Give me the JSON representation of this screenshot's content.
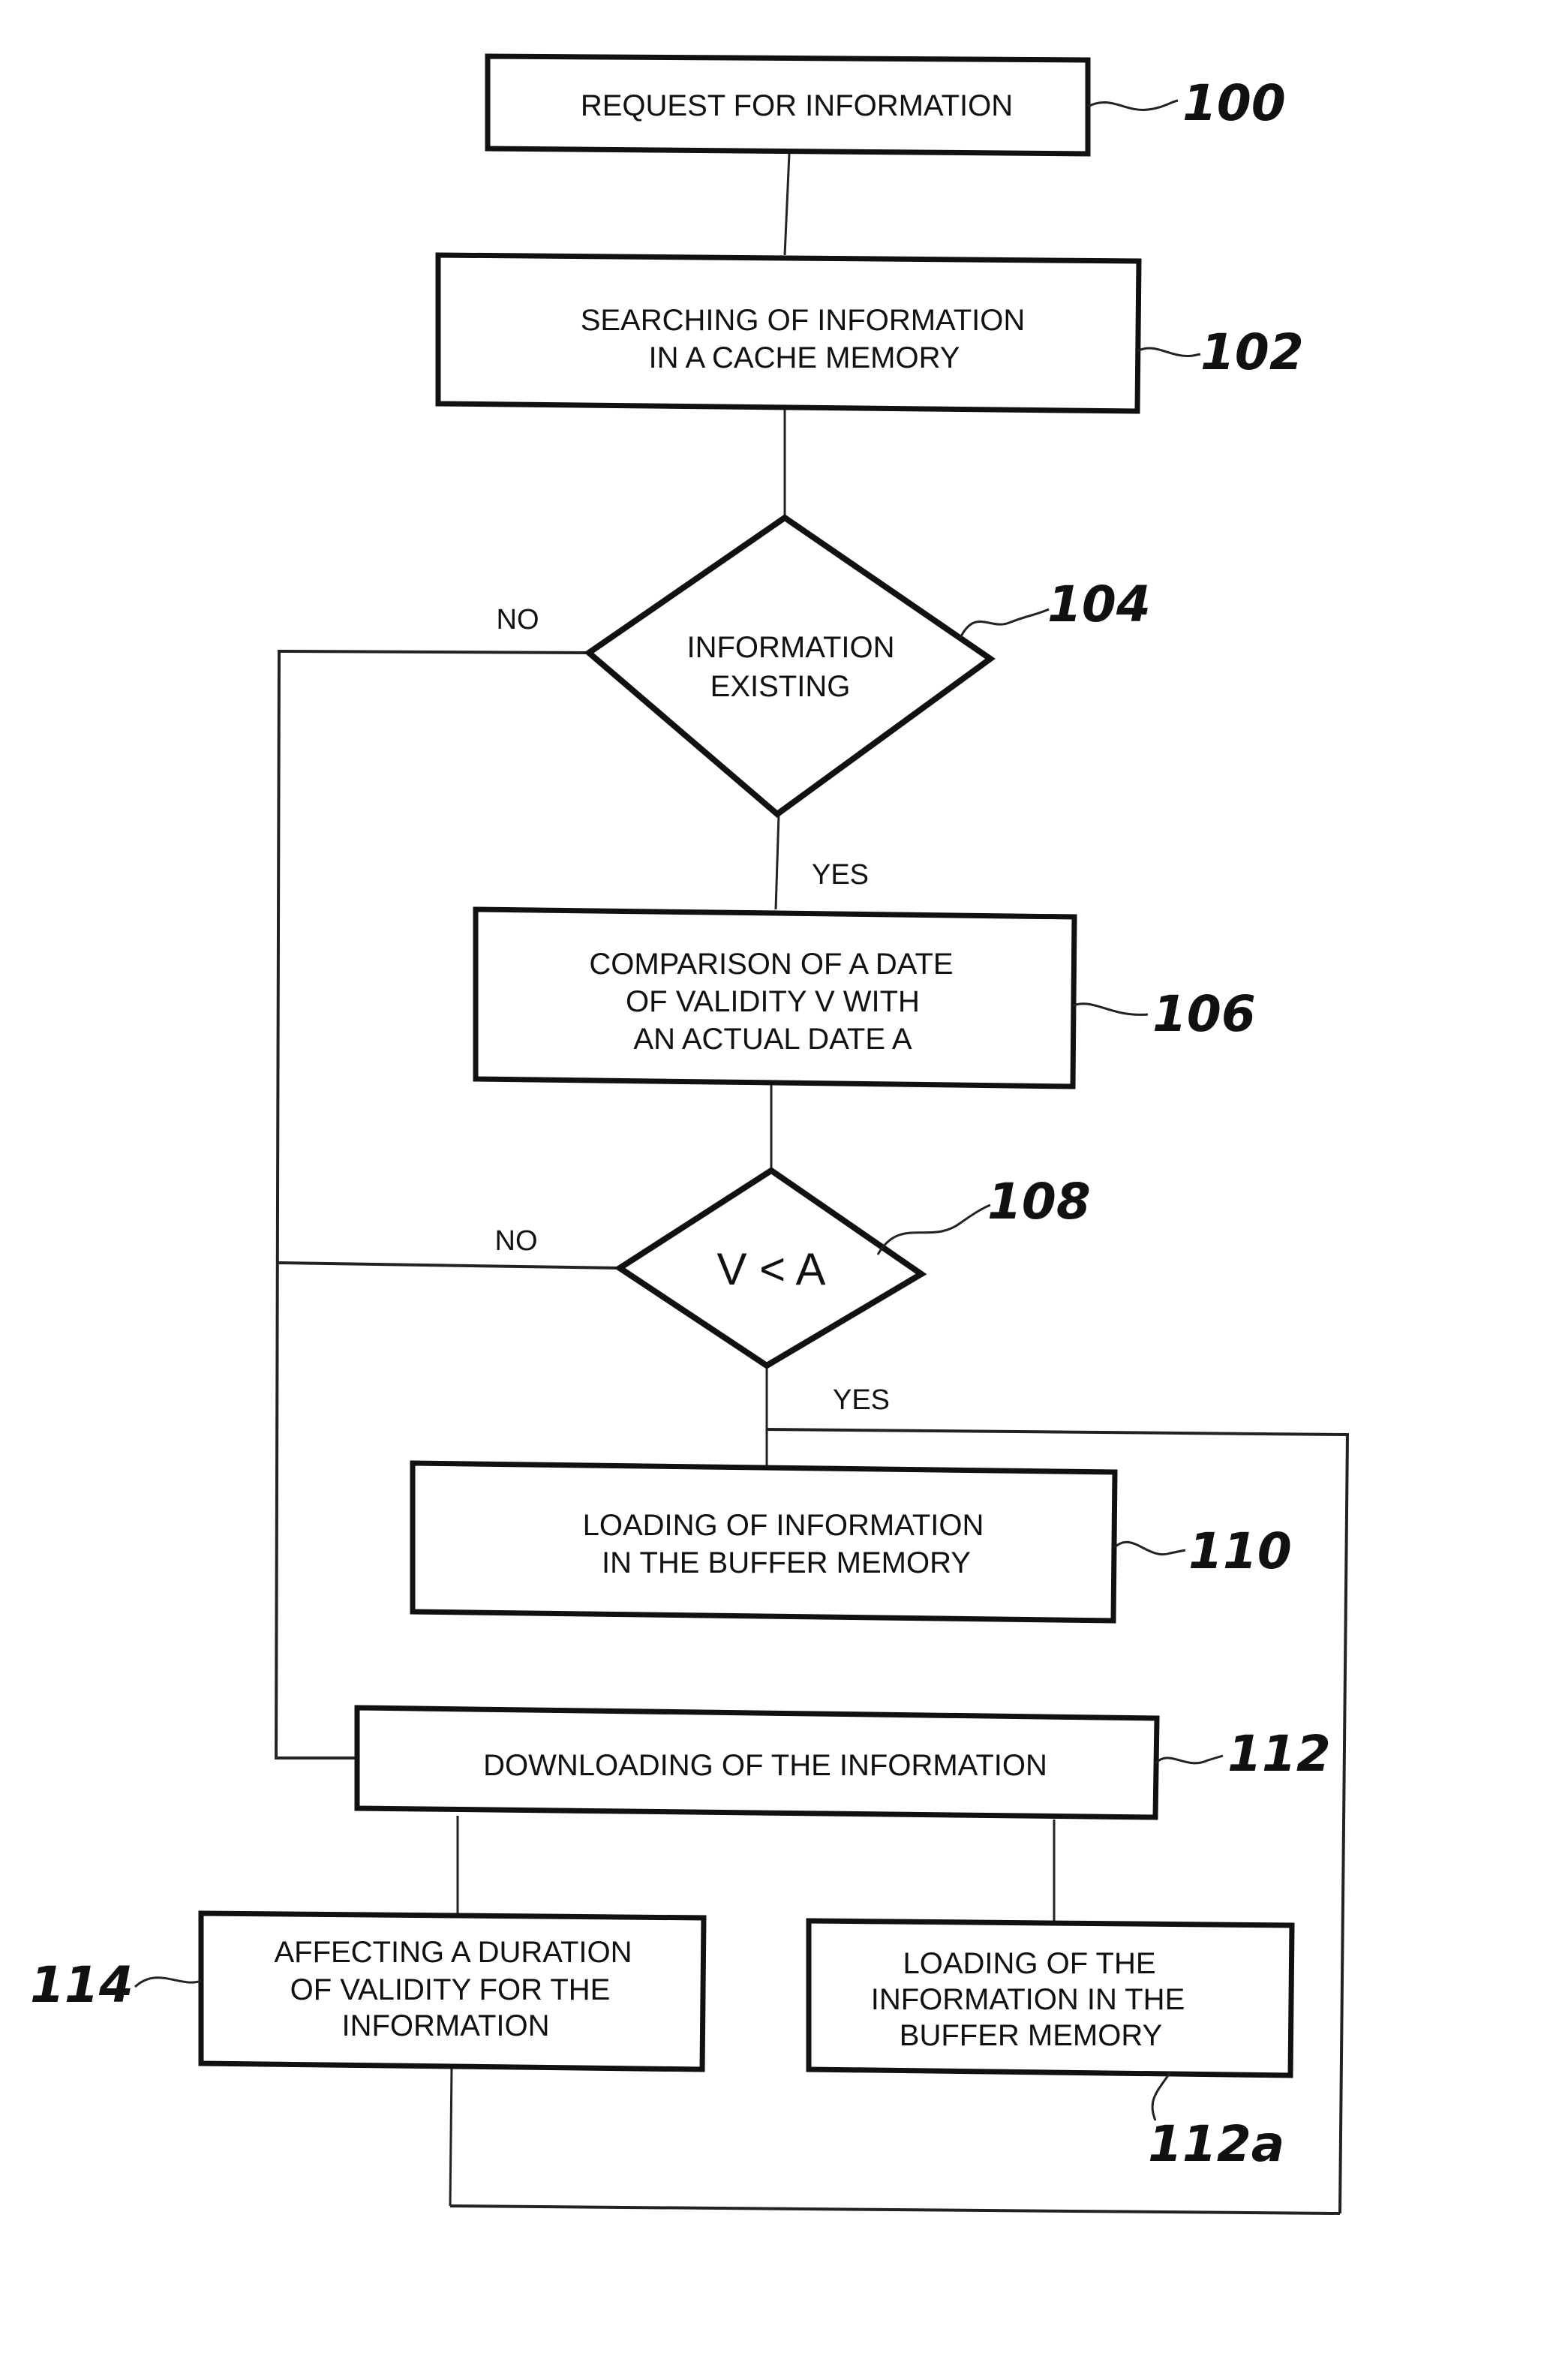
{
  "figure": {
    "type": "flowchart",
    "steps": {
      "s100": {
        "ref": "100",
        "lines": [
          "REQUEST FOR INFORMATION"
        ]
      },
      "s102": {
        "ref": "102",
        "lines": [
          "SEARCHING OF INFORMATION",
          "IN A CACHE MEMORY"
        ]
      },
      "s104": {
        "ref": "104",
        "lines": [
          "INFORMATION",
          "EXISTING"
        ]
      },
      "s106": {
        "ref": "106",
        "lines": [
          "COMPARISON OF A DATE",
          "OF VALIDITY V WITH",
          "AN ACTUAL DATE A"
        ]
      },
      "s108": {
        "ref": "108",
        "lines": [
          "V < A"
        ]
      },
      "s110": {
        "ref": "110",
        "lines": [
          "LOADING OF INFORMATION",
          "IN THE BUFFER MEMORY"
        ]
      },
      "s112": {
        "ref": "112",
        "lines": [
          "DOWNLOADING OF THE INFORMATION"
        ]
      },
      "s114": {
        "ref": "114",
        "lines": [
          "AFFECTING A DURATION",
          "OF VALIDITY FOR THE",
          "INFORMATION"
        ]
      },
      "s112a": {
        "ref": "112a",
        "lines": [
          "LOADING OF THE",
          "INFORMATION IN THE",
          "BUFFER MEMORY"
        ]
      }
    },
    "branch_labels": {
      "d104_no": "NO",
      "d104_yes": "YES",
      "d108_no": "NO",
      "d108_yes": "YES"
    }
  }
}
